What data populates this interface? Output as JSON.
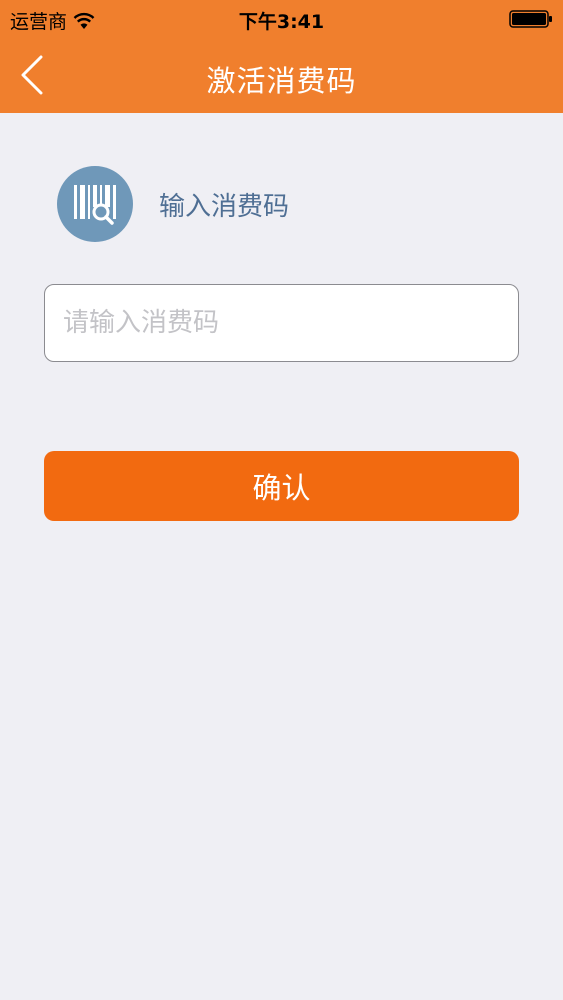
{
  "status_bar": {
    "carrier": "运营商",
    "time": "下午3:41"
  },
  "nav": {
    "title": "激活消费码",
    "back_icon": "chevron-left-icon"
  },
  "section": {
    "icon": "barcode-search-icon",
    "label": "输入消费码"
  },
  "input": {
    "value": "",
    "placeholder": "请输入消费码"
  },
  "confirm_button": {
    "label": "确认"
  },
  "colors": {
    "brand_orange": "#f07f2d",
    "button_orange": "#f26a10",
    "icon_blue": "#6f98b9",
    "label_blue": "#4f6f94",
    "background": "#efeff4"
  }
}
